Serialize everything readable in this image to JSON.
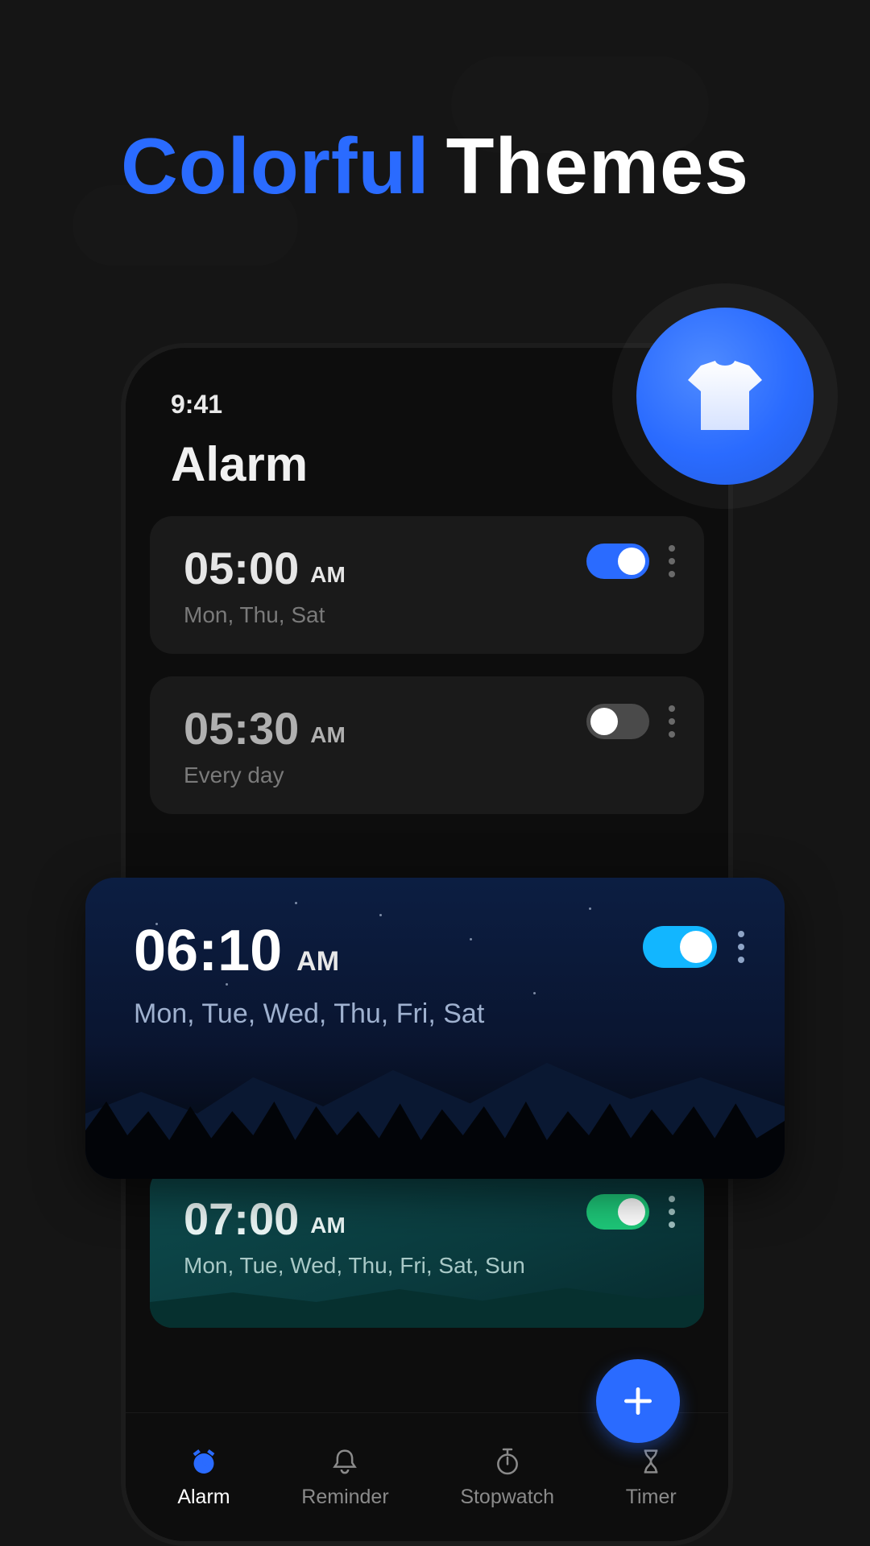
{
  "hero": {
    "word1": "Colorful",
    "word2": "Themes"
  },
  "colors": {
    "accent_blue": "#2a6bff",
    "accent_cyan": "#12b6ff",
    "accent_green": "#1ec879"
  },
  "status": {
    "time": "9:41"
  },
  "page_title": "Alarm",
  "theme_button_icon": "shirt-icon",
  "fab_icon": "plus-icon",
  "alarms": [
    {
      "time": "05:00",
      "ampm": "AM",
      "days": "Mon, Thu, Sat",
      "enabled": true,
      "variant": "plain"
    },
    {
      "time": "05:30",
      "ampm": "AM",
      "days": "Every day",
      "enabled": false,
      "variant": "plain"
    },
    {
      "time": "06:10",
      "ampm": "AM",
      "days": "Mon, Tue, Wed, Thu, Fri, Sat",
      "enabled": true,
      "variant": "night"
    },
    {
      "time": "07:00",
      "ampm": "AM",
      "days": "Mon, Tue, Wed, Thu, Fri, Sat, Sun",
      "enabled": true,
      "variant": "teal"
    }
  ],
  "nav": {
    "items": [
      {
        "label": "Alarm",
        "icon": "alarm-clock-icon",
        "active": true
      },
      {
        "label": "Reminder",
        "icon": "bell-icon",
        "active": false
      },
      {
        "label": "Stopwatch",
        "icon": "stopwatch-icon",
        "active": false
      },
      {
        "label": "Timer",
        "icon": "hourglass-icon",
        "active": false
      }
    ]
  }
}
